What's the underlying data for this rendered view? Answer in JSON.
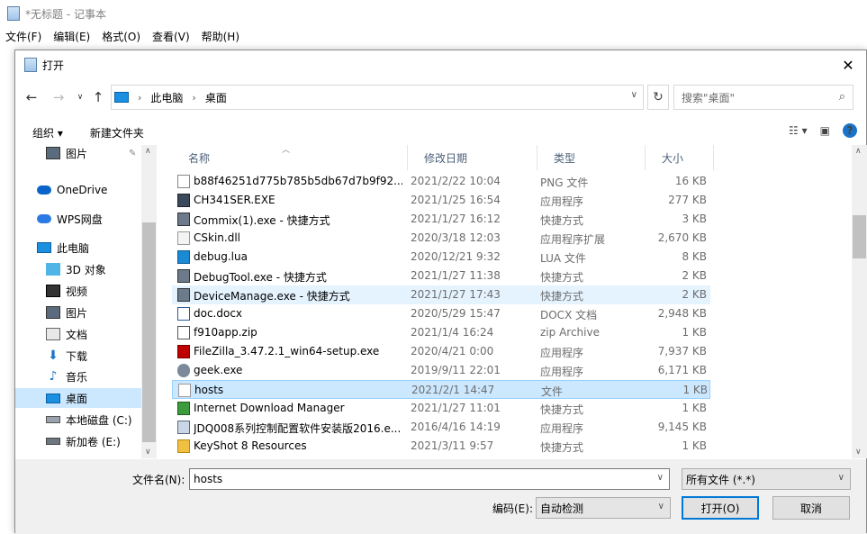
{
  "notepad": {
    "title": "*无标题 - 记事本",
    "menu": [
      "文件(F)",
      "编辑(E)",
      "格式(O)",
      "查看(V)",
      "帮助(H)"
    ]
  },
  "dialog": {
    "title": "打开",
    "address": {
      "crumbs": [
        "此电脑",
        "桌面"
      ]
    },
    "search": {
      "placeholder": "搜索\"桌面\""
    },
    "toolbar": {
      "organize": "组织 ▾",
      "new_folder": "新建文件夹"
    },
    "nav": [
      {
        "label": "图片",
        "icon": "pictures-icon",
        "pinned": true
      },
      {
        "label": "OneDrive",
        "icon": "onedrive-icon"
      },
      {
        "label": "WPS网盘",
        "icon": "wps-cloud-icon"
      },
      {
        "label": "此电脑",
        "icon": "this-pc-icon"
      },
      {
        "label": "3D 对象",
        "icon": "3d-objects-icon"
      },
      {
        "label": "视频",
        "icon": "videos-icon"
      },
      {
        "label": "图片",
        "icon": "pictures-icon"
      },
      {
        "label": "文档",
        "icon": "documents-icon"
      },
      {
        "label": "下载",
        "icon": "downloads-icon"
      },
      {
        "label": "音乐",
        "icon": "music-icon"
      },
      {
        "label": "桌面",
        "icon": "desktop-icon",
        "selected": true
      },
      {
        "label": "本地磁盘 (C:)",
        "icon": "local-disk-icon"
      },
      {
        "label": "新加卷 (E:)",
        "icon": "volume-icon"
      }
    ],
    "columns": [
      "名称",
      "修改日期",
      "类型",
      "大小"
    ],
    "files": [
      {
        "name": "b88f46251d775b785b5db67d7b9f92...",
        "date": "2021/2/22 10:04",
        "type": "PNG 文件",
        "size": "16 KB",
        "icon": "png-file-icon"
      },
      {
        "name": "CH341SER.EXE",
        "date": "2021/1/25 16:54",
        "type": "应用程序",
        "size": "277 KB",
        "icon": "exe-icon"
      },
      {
        "name": "Commix(1).exe - 快捷方式",
        "date": "2021/1/27 16:12",
        "type": "快捷方式",
        "size": "3 KB",
        "icon": "shortcut-icon"
      },
      {
        "name": "CSkin.dll",
        "date": "2020/3/18 12:03",
        "type": "应用程序扩展",
        "size": "2,670 KB",
        "icon": "dll-icon"
      },
      {
        "name": "debug.lua",
        "date": "2020/12/21 9:32",
        "type": "LUA 文件",
        "size": "8 KB",
        "icon": "vscode-icon"
      },
      {
        "name": "DebugTool.exe - 快捷方式",
        "date": "2021/1/27 11:38",
        "type": "快捷方式",
        "size": "2 KB",
        "icon": "shortcut-icon"
      },
      {
        "name": "DeviceManage.exe - 快捷方式",
        "date": "2021/1/27 17:43",
        "type": "快捷方式",
        "size": "2 KB",
        "icon": "shortcut-icon",
        "state": "hover"
      },
      {
        "name": "doc.docx",
        "date": "2020/5/29 15:47",
        "type": "DOCX 文档",
        "size": "2,948 KB",
        "icon": "docx-icon"
      },
      {
        "name": "f910app.zip",
        "date": "2021/1/4 16:24",
        "type": "zip Archive",
        "size": "1 KB",
        "icon": "zip-icon"
      },
      {
        "name": "FileZilla_3.47.2.1_win64-setup.exe",
        "date": "2020/4/21 0:00",
        "type": "应用程序",
        "size": "7,937 KB",
        "icon": "filezilla-icon"
      },
      {
        "name": "geek.exe",
        "date": "2019/9/11 22:01",
        "type": "应用程序",
        "size": "6,171 KB",
        "icon": "geek-icon"
      },
      {
        "name": "hosts",
        "date": "2021/2/1 14:47",
        "type": "文件",
        "size": "1 KB",
        "icon": "blank-file-icon",
        "state": "selected"
      },
      {
        "name": "Internet Download Manager",
        "date": "2021/1/27 11:01",
        "type": "快捷方式",
        "size": "1 KB",
        "icon": "idm-icon"
      },
      {
        "name": "JDQ008系列控制配置软件安装版2016.e...",
        "date": "2016/4/16 14:19",
        "type": "应用程序",
        "size": "9,145 KB",
        "icon": "installer-icon"
      },
      {
        "name": "KeyShot 8 Resources",
        "date": "2021/3/11 9:57",
        "type": "快捷方式",
        "size": "1 KB",
        "icon": "folder-shortcut-icon"
      }
    ],
    "bottom": {
      "filename_label": "文件名(N):",
      "filename_value": "hosts",
      "filter": "所有文件  (*.*)",
      "encoding_label": "编码(E):",
      "encoding_value": "自动检测",
      "open_button": "打开(O)",
      "cancel_button": "取消"
    }
  }
}
